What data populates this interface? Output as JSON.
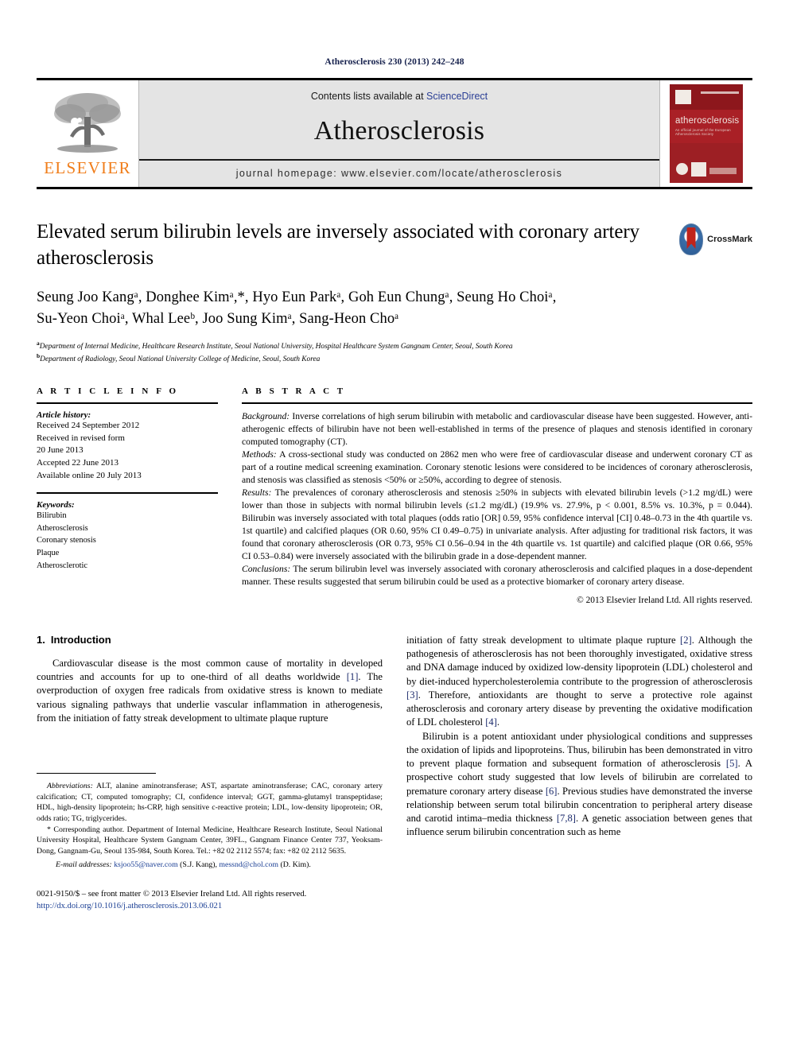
{
  "running_head": "Atherosclerosis 230 (2013) 242–248",
  "masthead": {
    "publisher_wordmark": "ELSEVIER",
    "contents_prefix": "Contents lists available at ",
    "contents_link": "ScienceDirect",
    "journal_name": "Atherosclerosis",
    "homepage": "journal homepage: www.elsevier.com/locate/atherosclerosis",
    "cover_title": "atherosclerosis",
    "cover_subtitle": "An official journal of the European Atherosclerosis Society"
  },
  "article": {
    "title": "Elevated serum bilirubin levels are inversely associated with coronary artery atherosclerosis",
    "crossmark_label": "CrossMark",
    "authors_line_1": "Seung Joo Kangᵃ, Donghee Kimᵃ,*, Hyo Eun Parkᵃ, Goh Eun Chungᵃ, Seung Ho Choiᵃ,",
    "authors_line_2": "Su-Yeon Choiᵃ, Whal Leeᵇ, Joo Sung Kimᵃ, Sang-Heon Choᵃ",
    "authors": [
      {
        "name": "Seung Joo Kang",
        "sup": "a"
      },
      {
        "name": "Donghee Kim",
        "sup": "a,*"
      },
      {
        "name": "Hyo Eun Park",
        "sup": "a"
      },
      {
        "name": "Goh Eun Chung",
        "sup": "a"
      },
      {
        "name": "Seung Ho Choi",
        "sup": "a"
      },
      {
        "name": "Su-Yeon Choi",
        "sup": "a"
      },
      {
        "name": "Whal Lee",
        "sup": "b"
      },
      {
        "name": "Joo Sung Kim",
        "sup": "a"
      },
      {
        "name": "Sang-Heon Cho",
        "sup": "a"
      }
    ],
    "affiliation_a": "Department of Internal Medicine, Healthcare Research Institute, Seoul National University, Hospital Healthcare System Gangnam Center, Seoul, South Korea",
    "affiliation_b": "Department of Radiology, Seoul National University College of Medicine, Seoul, South Korea"
  },
  "article_info": {
    "heading": "A R T I C L E   I N F O",
    "history_label": "Article history:",
    "history": [
      "Received 24 September 2012",
      "Received in revised form",
      "20 June 2013",
      "Accepted 22 June 2013",
      "Available online 20 July 2013"
    ],
    "keywords_label": "Keywords:",
    "keywords": [
      "Bilirubin",
      "Atherosclerosis",
      "Coronary stenosis",
      "Plaque",
      "Atherosclerotic"
    ]
  },
  "abstract": {
    "heading": "A B S T R A C T",
    "background_label": "Background:",
    "background_text": " Inverse correlations of high serum bilirubin with metabolic and cardiovascular disease have been suggested. However, anti-atherogenic effects of bilirubin have not been well-established in terms of the presence of plaques and stenosis identified in coronary computed tomography (CT).",
    "methods_label": "Methods:",
    "methods_text": " A cross-sectional study was conducted on 2862 men who were free of cardiovascular disease and underwent coronary CT as part of a routine medical screening examination. Coronary stenotic lesions were considered to be incidences of coronary atherosclerosis, and stenosis was classified as stenosis <50% or ≥50%, according to degree of stenosis.",
    "results_label": "Results:",
    "results_text": " The prevalences of coronary atherosclerosis and stenosis ≥50% in subjects with elevated bilirubin levels (>1.2 mg/dL) were lower than those in subjects with normal bilirubin levels (≤1.2 mg/dL) (19.9% vs. 27.9%, p < 0.001, 8.5% vs. 10.3%, p = 0.044). Bilirubin was inversely associated with total plaques (odds ratio [OR] 0.59, 95% confidence interval [CI] 0.48–0.73 in the 4th quartile vs. 1st quartile) and calcified plaques (OR 0.60, 95% CI 0.49–0.75) in univariate analysis. After adjusting for traditional risk factors, it was found that coronary atherosclerosis (OR 0.73, 95% CI 0.56–0.94 in the 4th quartile vs. 1st quartile) and calcified plaque (OR 0.66, 95% CI 0.53–0.84) were inversely associated with the bilirubin grade in a dose-dependent manner.",
    "conclusions_label": "Conclusions:",
    "conclusions_text": " The serum bilirubin level was inversely associated with coronary atherosclerosis and calcified plaques in a dose-dependent manner. These results suggested that serum bilirubin could be used as a protective biomarker of coronary artery disease.",
    "copyright": "© 2013 Elsevier Ireland Ltd. All rights reserved."
  },
  "introduction": {
    "number": "1.",
    "heading": "Introduction",
    "para_1_a": "Cardiovascular disease is the most common cause of mortality in developed countries and accounts for up to one-third of all deaths worldwide ",
    "para_1_ref1": "[1]",
    "para_1_b": ". The overproduction of oxygen free radicals from oxidative stress is known to mediate various signaling pathways that underlie vascular inflammation in atherogenesis, from the initiation of fatty streak development to ultimate plaque rupture ",
    "para_1_ref2": "[2]",
    "para_1_c": ". Although the pathogenesis of atherosclerosis has not been thoroughly investigated, oxidative stress and DNA damage induced by oxidized low-density lipoprotein (LDL) cholesterol and by diet-induced hypercholesterolemia contribute to the progression of atherosclerosis ",
    "para_1_ref3": "[3]",
    "para_1_d": ". Therefore, antioxidants are thought to serve a protective role against atherosclerosis and coronary artery disease by preventing the oxidative modification of LDL cholesterol ",
    "para_1_ref4": "[4]",
    "para_1_e": ".",
    "para_2_a": "Bilirubin is a potent antioxidant under physiological conditions and suppresses the oxidation of lipids and lipoproteins. Thus, bilirubin has been demonstrated in vitro to prevent plaque formation and subsequent formation of atherosclerosis ",
    "para_2_ref5": "[5]",
    "para_2_b": ". A prospective cohort study suggested that low levels of bilirubin are correlated to premature coronary artery disease ",
    "para_2_ref6": "[6]",
    "para_2_c": ". Previous studies have demonstrated the inverse relationship between serum total bilirubin concentration to peripheral artery disease and carotid intima–media thickness ",
    "para_2_ref78": "[7,8]",
    "para_2_d": ". A genetic association between genes that influence serum bilirubin concentration such as heme"
  },
  "footnotes": {
    "abbrev_label": "Abbreviations:",
    "abbrev_text": " ALT, alanine aminotransferase; AST, aspartate aminotransferase; CAC, coronary artery calcification; CT, computed tomography; CI, confidence interval; GGT, gamma-glutamyl transpeptidase; HDL, high-density lipoprotein; hs-CRP, high sensitive c-reactive protein; LDL, low-density lipoprotein; OR, odds ratio; TG, triglycerides.",
    "corresponding_text": "* Corresponding author. Department of Internal Medicine, Healthcare Research Institute, Seoul National University Hospital, Healthcare System Gangnam Center, 39FL., Gangnam Finance Center 737, Yeoksam-Dong, Gangnam-Gu, Seoul 135-984, South Korea. Tel.: +82 02 2112 5574; fax: +82 02 2112 5635.",
    "email_label": "E-mail addresses:",
    "email_1": "ksjoo55@naver.com",
    "email_1_owner": " (S.J. Kang), ",
    "email_2": "messnd@chol.com",
    "email_2_owner": " (D. Kim)."
  },
  "imprint": {
    "issn_line": "0021-9150/$ – see front matter © 2013 Elsevier Ireland Ltd. All rights reserved.",
    "doi": "http://dx.doi.org/10.1016/j.atherosclerosis.2013.06.021"
  },
  "colors": {
    "running_head": "#16214d",
    "sciencedirect_link": "#2a3e95",
    "elsevier_orange": "#f07d1a",
    "cover_red": "#9d1f24",
    "reference_blue": "#1b2a6b",
    "link_blue": "#1b3f94",
    "masthead_gray": "#e4e4e4"
  }
}
